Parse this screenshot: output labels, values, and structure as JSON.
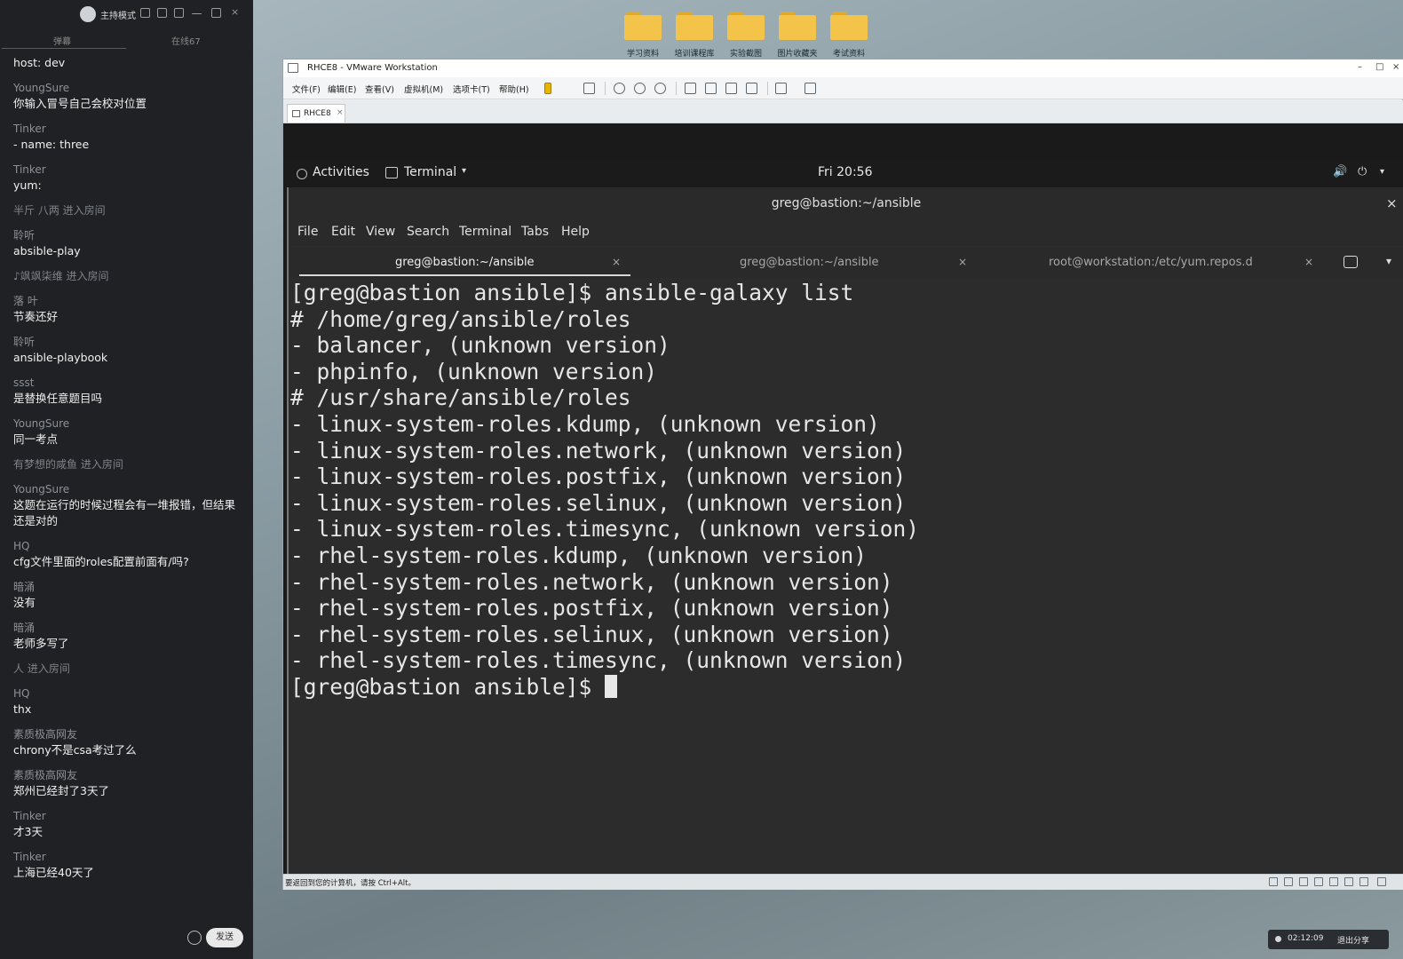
{
  "chat": {
    "mode_label": "主持模式",
    "tabs": [
      "弹幕",
      "在线67"
    ],
    "messages": [
      {
        "user": "",
        "text": "host: dev"
      },
      {
        "user": "YoungSure",
        "text": "你输入冒号自己会校对位置"
      },
      {
        "user": "Tinker",
        "text": "- name: three"
      },
      {
        "user": "Tinker",
        "text": "yum:"
      },
      {
        "user": "半斤 八两 进入房间",
        "text": ""
      },
      {
        "user": "聆听",
        "text": "absible-play"
      },
      {
        "user": "♪飒飒柒维 进入房间",
        "text": ""
      },
      {
        "user": "  落  叶",
        "text": "节奏还好"
      },
      {
        "user": "聆听",
        "text": "ansible-playbook"
      },
      {
        "user": "ssst",
        "text": "是替换任意题目吗"
      },
      {
        "user": "YoungSure",
        "text": "同一考点"
      },
      {
        "user": "有梦想的咸鱼 进入房间",
        "text": ""
      },
      {
        "user": "YoungSure",
        "text": "这题在运行的时候过程会有一堆报错，但结果还是对的"
      },
      {
        "user": "HQ",
        "text": "cfg文件里面的roles配置前面有/吗?"
      },
      {
        "user": "暗涌",
        "text": "没有"
      },
      {
        "user": "暗涌",
        "text": "老师多写了"
      },
      {
        "user": "人 进入房间",
        "text": ""
      },
      {
        "user": "HQ",
        "text": "thx"
      },
      {
        "user": "素质极高网友",
        "text": "chrony不是csa考过了么"
      },
      {
        "user": "素质极高网友",
        "text": "郑州已经封了3天了"
      },
      {
        "user": "Tinker",
        "text": "才3天"
      },
      {
        "user": "Tinker",
        "text": "上海已经40天了"
      }
    ],
    "send_label": "发送"
  },
  "desktop": {
    "folders": [
      "学习资料",
      "培训课程库",
      "实验截图",
      "图片收藏夹",
      "考试资料"
    ]
  },
  "vmware": {
    "title": "RHCE8 - VMware Workstation",
    "menu": [
      "文件(F)",
      "编辑(E)",
      "查看(V)",
      "虚拟机(M)",
      "选项卡(T)",
      "帮助(H)"
    ],
    "tab_label": "RHCE8",
    "status_text": "要返回到您的计算机，请按 Ctrl+Alt。"
  },
  "gnome": {
    "activities": "Activities",
    "app": "Terminal",
    "clock": "Fri 20:56"
  },
  "terminal": {
    "title": "greg@bastion:~/ansible",
    "menu": [
      "File",
      "Edit",
      "View",
      "Search",
      "Terminal",
      "Tabs",
      "Help"
    ],
    "tabs": [
      {
        "label": "greg@bastion:~/ansible",
        "active": true
      },
      {
        "label": "greg@bastion:~/ansible",
        "active": false
      },
      {
        "label": "root@workstation:/etc/yum.repos.d",
        "active": false
      }
    ],
    "lines": [
      "[greg@bastion ansible]$ ansible-galaxy list",
      "# /home/greg/ansible/roles",
      "- balancer, (unknown version)",
      "- phpinfo, (unknown version)",
      "# /usr/share/ansible/roles",
      "- linux-system-roles.kdump, (unknown version)",
      "- linux-system-roles.network, (unknown version)",
      "- linux-system-roles.postfix, (unknown version)",
      "- linux-system-roles.selinux, (unknown version)",
      "- linux-system-roles.timesync, (unknown version)",
      "- rhel-system-roles.kdump, (unknown version)",
      "- rhel-system-roles.network, (unknown version)",
      "- rhel-system-roles.postfix, (unknown version)",
      "- rhel-system-roles.selinux, (unknown version)",
      "- rhel-system-roles.timesync, (unknown version)"
    ],
    "prompt": "[greg@bastion ansible]$ "
  },
  "share": {
    "elapsed": "02:12:09",
    "stop_label": "退出分享"
  }
}
